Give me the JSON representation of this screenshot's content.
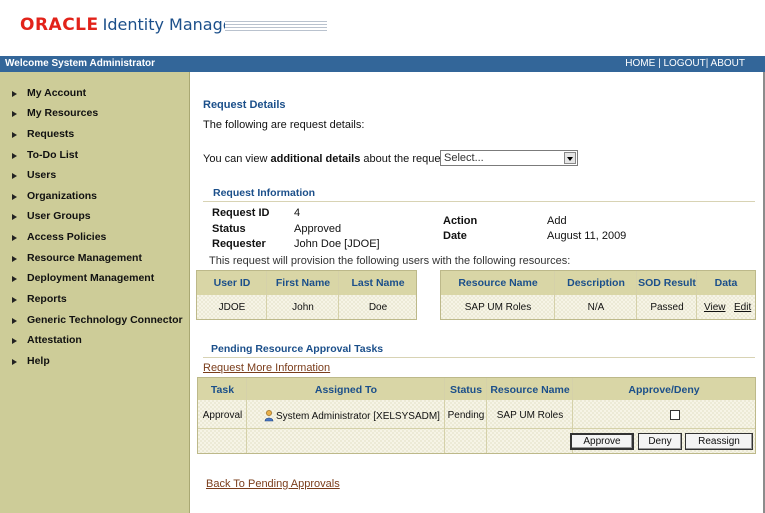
{
  "header": {
    "brand_oracle": "ORACLE",
    "brand_product": "Identity Manager"
  },
  "topbar": {
    "welcome": "Welcome System Administrator",
    "links": [
      "HOME",
      "LOGOUT",
      "ABOUT"
    ],
    "separator": "|"
  },
  "sidebar": {
    "items": [
      {
        "label": "My Account"
      },
      {
        "label": "My Resources"
      },
      {
        "label": "Requests"
      },
      {
        "label": "To-Do List"
      },
      {
        "label": "Users"
      },
      {
        "label": "Organizations"
      },
      {
        "label": "User Groups"
      },
      {
        "label": "Access Policies"
      },
      {
        "label": "Resource Management"
      },
      {
        "label": "Deployment Management"
      },
      {
        "label": "Reports"
      },
      {
        "label": "Generic Technology Connector"
      },
      {
        "label": "Attestation"
      },
      {
        "label": "Help"
      }
    ]
  },
  "main": {
    "title": "Request Details",
    "intro": "The following are request details:",
    "view_prefix": "You can view ",
    "view_bold": "additional details",
    "view_suffix": " about the request:",
    "select_value": "Select...",
    "request_info": {
      "heading": "Request Information",
      "request_id_label": "Request ID",
      "request_id": "4",
      "status_label": "Status",
      "status": "Approved",
      "requester_label": "Requester",
      "requester": "John Doe [JDOE]",
      "action_label": "Action",
      "action": "Add",
      "date_label": "Date",
      "date": "August 11, 2009",
      "provision_text": "This request will provision the following users with the following resources:"
    },
    "users_table": {
      "headers": [
        "User ID",
        "First Name",
        "Last Name"
      ],
      "rows": [
        [
          "JDOE",
          "John",
          "Doe"
        ]
      ]
    },
    "resources_table": {
      "headers": [
        "Resource Name",
        "Description",
        "SOD Result",
        "Data"
      ],
      "rows": [
        {
          "resource": "SAP UM Roles",
          "description": "N/A",
          "sod": "Passed",
          "view": "View",
          "edit": "Edit"
        }
      ]
    },
    "pending": {
      "heading": "Pending Resource Approval Tasks",
      "more_info_link": "Request More Information",
      "headers": [
        "Task",
        "Assigned To",
        "Status",
        "Resource Name",
        "Approve/Deny"
      ],
      "rows": [
        {
          "task": "Approval",
          "assigned_to": "System Administrator [XELSYSADM]",
          "status": "Pending",
          "resource": "SAP UM Roles",
          "approved": false
        }
      ],
      "buttons": {
        "approve": "Approve",
        "deny": "Deny",
        "reassign": "Reassign"
      }
    },
    "back_link": "Back To Pending Approvals"
  },
  "colors": {
    "brand_red": "#e2231a",
    "brand_blue": "#1b4f8a",
    "topbar": "#336699",
    "sidebar": "#cdcc98",
    "table_header": "#d9d6a6"
  }
}
